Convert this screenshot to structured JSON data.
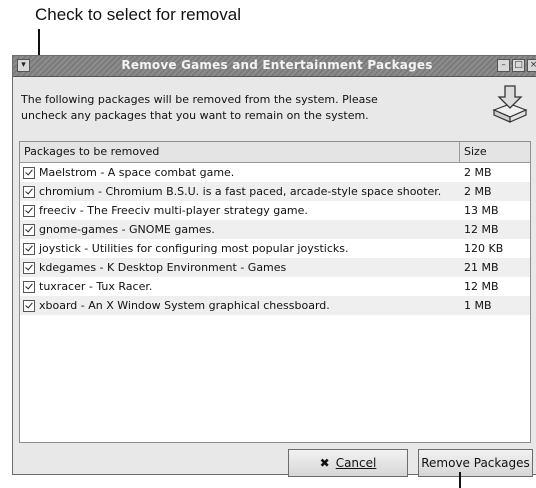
{
  "callout": {
    "top_text": "Check to select for removal"
  },
  "window": {
    "title": "Remove Games and Entertainment Packages",
    "controls": {
      "menu": "▾",
      "minimize": "–",
      "maximize": "□",
      "close": "×"
    },
    "message_line1": "The following packages will be removed from the system.  Please",
    "message_line2": "uncheck any packages that you want to remain on the system.",
    "icon": "package-remove-icon"
  },
  "list": {
    "columns": {
      "name": "Packages to be removed",
      "size": "Size"
    },
    "rows": [
      {
        "name": "Maelstrom - A space combat game.",
        "size": "2 MB",
        "checked": true
      },
      {
        "name": "chromium - Chromium B.S.U. is a fast paced, arcade-style space shooter.",
        "size": "2 MB",
        "checked": true
      },
      {
        "name": "freeciv - The Freeciv multi-player strategy game.",
        "size": "13 MB",
        "checked": true
      },
      {
        "name": "gnome-games - GNOME games.",
        "size": "12 MB",
        "checked": true
      },
      {
        "name": "joystick - Utilities for configuring most popular joysticks.",
        "size": "120 KB",
        "checked": true
      },
      {
        "name": "kdegames - K Desktop Environment - Games",
        "size": "21 MB",
        "checked": true
      },
      {
        "name": "tuxracer - Tux Racer.",
        "size": "12 MB",
        "checked": true
      },
      {
        "name": "xboard - An X Window System graphical chessboard.",
        "size": "1 MB",
        "checked": true
      }
    ]
  },
  "buttons": {
    "cancel": "Cancel",
    "cancel_icon": "✖",
    "remove": "Remove Packages"
  }
}
